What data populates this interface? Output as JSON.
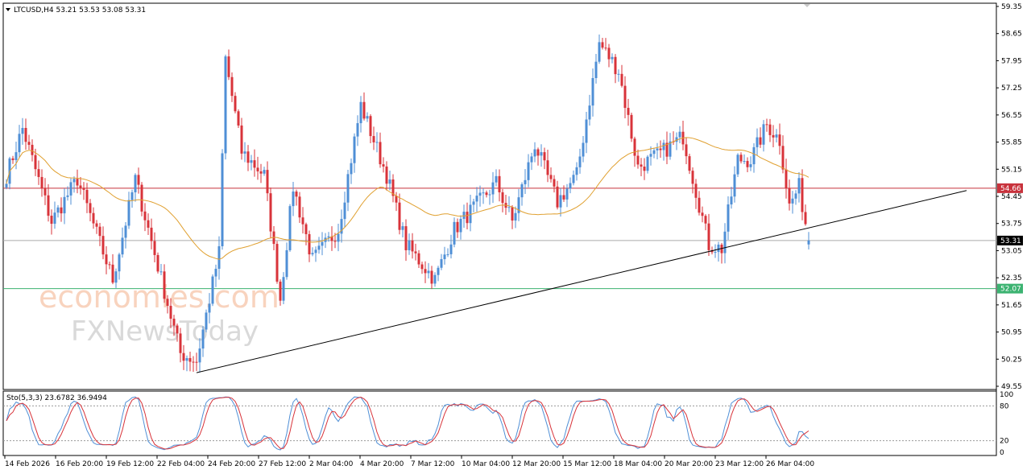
{
  "header": {
    "symbol_label": "LTCUSD,H4  53.21 53.53 53.08 53.31"
  },
  "indicator": {
    "label": "Sto(5,3,3) 23.6782 36.9494",
    "levels": [
      100,
      80,
      20,
      0
    ]
  },
  "watermark": {
    "line1": "economies.com",
    "line2": "FXNewsToday"
  },
  "colors": {
    "bull": "#4f8fd6",
    "bear": "#d8333a",
    "ma": "#e0a030",
    "resistance": "#c8323c",
    "support": "#3cb371",
    "trendline": "#000000",
    "current": "#aaaaaa",
    "stoch_main": "#4f8fd6",
    "stoch_signal": "#d8333a"
  },
  "chart_data": {
    "type": "candlestick",
    "symbol": "LTCUSD",
    "timeframe": "H4",
    "ylim": [
      49.55,
      59.35
    ],
    "y_ticks": [
      "59.35",
      "58.65",
      "57.95",
      "57.25",
      "56.55",
      "55.85",
      "55.15",
      "54.45",
      "53.75",
      "53.05",
      "52.35",
      "51.65",
      "50.95",
      "50.25",
      "49.55"
    ],
    "x_ticks": [
      "14 Feb 2026",
      "16 Feb 20:00",
      "19 Feb 12:00",
      "22 Feb 04:00",
      "24 Feb 20:00",
      "27 Feb 12:00",
      "2 Mar 04:00",
      "4 Mar 20:00",
      "7 Mar 12:00",
      "10 Mar 04:00",
      "12 Mar 20:00",
      "15 Mar 12:00",
      "18 Mar 04:00",
      "20 Mar 20:00",
      "23 Mar 12:00",
      "26 Mar 04:00"
    ],
    "bar_count": 250,
    "key_prices": [
      {
        "bar": 0,
        "price": 55.0
      },
      {
        "bar": 5,
        "price": 56.2
      },
      {
        "bar": 14,
        "price": 53.8
      },
      {
        "bar": 22,
        "price": 54.9
      },
      {
        "bar": 33,
        "price": 52.3
      },
      {
        "bar": 40,
        "price": 54.9
      },
      {
        "bar": 54,
        "price": 50.4
      },
      {
        "bar": 59,
        "price": 50.2
      },
      {
        "bar": 66,
        "price": 53.0
      },
      {
        "bar": 68,
        "price": 58.0
      },
      {
        "bar": 73,
        "price": 55.6
      },
      {
        "bar": 80,
        "price": 55.0
      },
      {
        "bar": 85,
        "price": 51.8
      },
      {
        "bar": 89,
        "price": 54.7
      },
      {
        "bar": 95,
        "price": 52.8
      },
      {
        "bar": 103,
        "price": 53.6
      },
      {
        "bar": 110,
        "price": 56.8
      },
      {
        "bar": 118,
        "price": 55.0
      },
      {
        "bar": 124,
        "price": 53.2
      },
      {
        "bar": 133,
        "price": 52.3
      },
      {
        "bar": 139,
        "price": 53.6
      },
      {
        "bar": 152,
        "price": 54.8
      },
      {
        "bar": 157,
        "price": 53.8
      },
      {
        "bar": 164,
        "price": 55.8
      },
      {
        "bar": 171,
        "price": 54.3
      },
      {
        "bar": 177,
        "price": 55.0
      },
      {
        "bar": 184,
        "price": 58.4
      },
      {
        "bar": 190,
        "price": 57.7
      },
      {
        "bar": 196,
        "price": 55.2
      },
      {
        "bar": 202,
        "price": 55.5
      },
      {
        "bar": 210,
        "price": 56.0
      },
      {
        "bar": 218,
        "price": 53.2
      },
      {
        "bar": 222,
        "price": 53.1
      },
      {
        "bar": 227,
        "price": 55.4
      },
      {
        "bar": 231,
        "price": 55.4
      },
      {
        "bar": 236,
        "price": 56.3
      },
      {
        "bar": 240,
        "price": 55.9
      },
      {
        "bar": 243,
        "price": 54.2
      },
      {
        "bar": 246,
        "price": 54.7
      },
      {
        "bar": 249,
        "price": 53.31
      }
    ],
    "last": {
      "open": 53.21,
      "high": 53.53,
      "low": 53.08,
      "close": 53.31
    },
    "horizontal_lines": [
      {
        "name": "resistance",
        "price": 54.66,
        "label": "54.66"
      },
      {
        "name": "support",
        "price": 52.07,
        "label": "52.07"
      },
      {
        "name": "current",
        "price": 53.31,
        "label": "53.31"
      }
    ],
    "trendline": {
      "start": {
        "bar": 59,
        "price": 49.9
      },
      "end": {
        "bar": 298,
        "price": 54.6
      }
    },
    "ma_period": 50,
    "stochastic": {
      "k": 5,
      "d": 3,
      "slowing": 3,
      "main": 23.6782,
      "signal": 36.9494,
      "ylim": [
        0,
        100
      ]
    }
  }
}
